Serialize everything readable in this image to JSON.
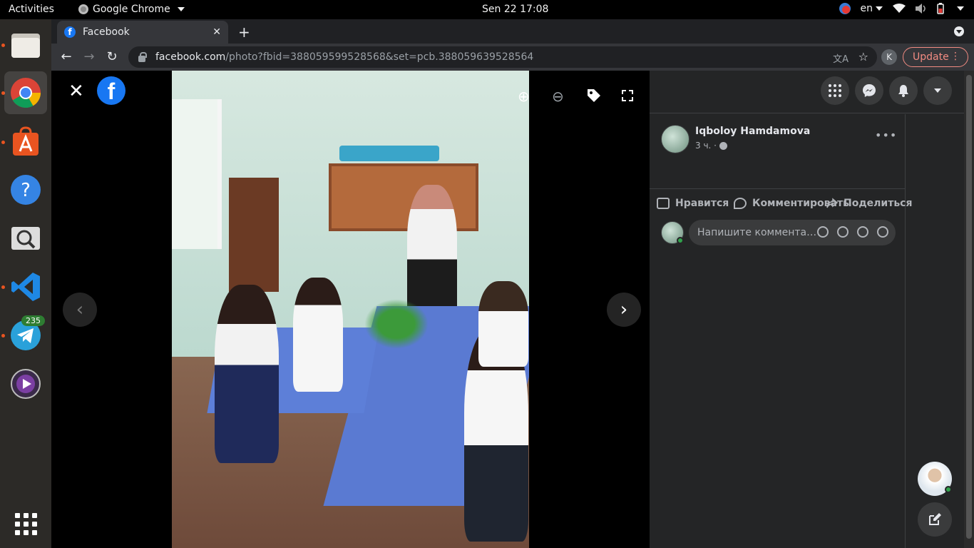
{
  "topbar": {
    "activities": "Activities",
    "app_menu": "Google Chrome",
    "clock": "Sen 22  17:08",
    "keyboard_layout": "en"
  },
  "dock": {
    "apps": [
      {
        "name": "files-icon"
      },
      {
        "name": "chrome-icon"
      },
      {
        "name": "software-icon"
      },
      {
        "name": "help-icon"
      },
      {
        "name": "screenshot-icon"
      },
      {
        "name": "vscode-icon"
      },
      {
        "name": "telegram-icon"
      },
      {
        "name": "media-player-icon"
      }
    ],
    "telegram_badge": "235"
  },
  "browser": {
    "tab_title": "Facebook",
    "url_host": "facebook.com",
    "url_path": "/photo?fbid=388059599528568&set=pcb.388059639528564",
    "profile_initial": "K",
    "update_label": "Update"
  },
  "post": {
    "author": "Iqboloy Hamdamova",
    "time": "3 ч. ·",
    "like_label": "Нравится",
    "comment_label": "Комментировать",
    "share_label": "Поделиться",
    "comment_placeholder": "Напишите коммента…"
  },
  "colors": {
    "facebook_blue": "#1877f2",
    "update_red": "#f28b82",
    "online_green": "#31a24c",
    "ubuntu_orange": "#e95420"
  }
}
